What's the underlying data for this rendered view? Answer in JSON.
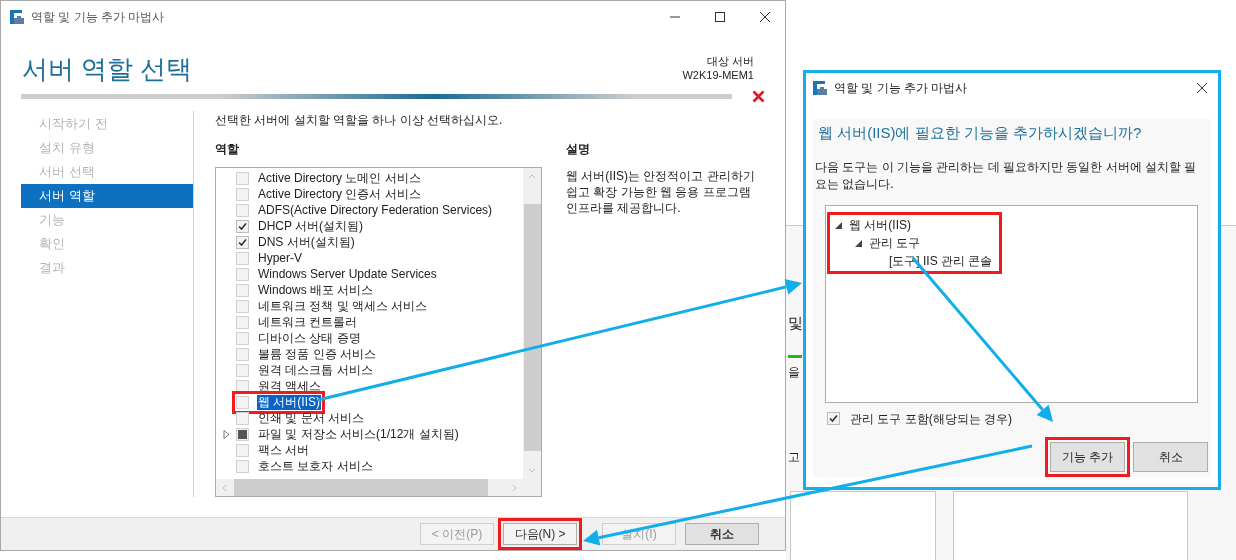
{
  "main_window": {
    "title": "역할 및 기능 추가 마법사",
    "heading": "서버 역할 선택",
    "target_label": "대상 서버",
    "target_server": "W2K19-MEM1",
    "nav": [
      {
        "label": "시작하기 전",
        "selected": false
      },
      {
        "label": "설치 유형",
        "selected": false
      },
      {
        "label": "서버 선택",
        "selected": false
      },
      {
        "label": "서버 역할",
        "selected": true
      },
      {
        "label": "기능",
        "selected": false
      },
      {
        "label": "확인",
        "selected": false
      },
      {
        "label": "결과",
        "selected": false
      }
    ],
    "instruction": "선택한 서버에 설치할 역할을 하나 이상 선택하십시오.",
    "roles_heading": "역할",
    "roles": [
      {
        "label": "Active Directory 노메인 서비스",
        "checked": false,
        "partial": false,
        "selected": false,
        "expandable": false,
        "highlighted": false
      },
      {
        "label": "Active Directory 인증서 서비스",
        "checked": false,
        "partial": false,
        "selected": false,
        "expandable": false,
        "highlighted": false
      },
      {
        "label": "ADFS(Active Directory Federation Services)",
        "checked": false,
        "partial": false,
        "selected": false,
        "expandable": false,
        "highlighted": false
      },
      {
        "label": "DHCP 서버(설치됨)",
        "checked": true,
        "partial": false,
        "selected": false,
        "expandable": false,
        "highlighted": false
      },
      {
        "label": "DNS 서버(설치됨)",
        "checked": true,
        "partial": false,
        "selected": false,
        "expandable": false,
        "highlighted": false
      },
      {
        "label": "Hyper-V",
        "checked": false,
        "partial": false,
        "selected": false,
        "expandable": false,
        "highlighted": false
      },
      {
        "label": "Windows Server Update Services",
        "checked": false,
        "partial": false,
        "selected": false,
        "expandable": false,
        "highlighted": false
      },
      {
        "label": "Windows 배포 서비스",
        "checked": false,
        "partial": false,
        "selected": false,
        "expandable": false,
        "highlighted": false
      },
      {
        "label": "네트워크 정책 및 액세스 서비스",
        "checked": false,
        "partial": false,
        "selected": false,
        "expandable": false,
        "highlighted": false
      },
      {
        "label": "네트워크 컨트롤러",
        "checked": false,
        "partial": false,
        "selected": false,
        "expandable": false,
        "highlighted": false
      },
      {
        "label": "디바이스 상태 증명",
        "checked": false,
        "partial": false,
        "selected": false,
        "expandable": false,
        "highlighted": false
      },
      {
        "label": "볼륨 정품 인증 서비스",
        "checked": false,
        "partial": false,
        "selected": false,
        "expandable": false,
        "highlighted": false
      },
      {
        "label": "원격 데스크톱 서비스",
        "checked": false,
        "partial": false,
        "selected": false,
        "expandable": false,
        "highlighted": false
      },
      {
        "label": "원격 액세스",
        "checked": false,
        "partial": false,
        "selected": false,
        "expandable": false,
        "highlighted": false
      },
      {
        "label": "웹 서버(IIS)",
        "checked": false,
        "partial": false,
        "selected": true,
        "expandable": false,
        "highlighted": true
      },
      {
        "label": "인쇄 및 문서 서비스",
        "checked": false,
        "partial": false,
        "selected": false,
        "expandable": false,
        "highlighted": false
      },
      {
        "label": "파일 및 저장소 서비스(1/12개 설치됨)",
        "checked": false,
        "partial": true,
        "selected": false,
        "expandable": true,
        "highlighted": false
      },
      {
        "label": "팩스 서버",
        "checked": false,
        "partial": false,
        "selected": false,
        "expandable": false,
        "highlighted": false
      },
      {
        "label": "호스트 보호자 서비스",
        "checked": false,
        "partial": false,
        "selected": false,
        "expandable": false,
        "highlighted": false
      }
    ],
    "description_heading": "설명",
    "description": "웹 서버(IIS)는 안정적이고 관리하기 쉽고 확장 가능한 웹 응용 프로그램 인프라를 제공합니다.",
    "buttons": [
      {
        "label": "< 이전(P)",
        "disabled": true,
        "default": false,
        "highlighted": false
      },
      {
        "label": "다음(N) >",
        "disabled": false,
        "default": false,
        "highlighted": true
      },
      {
        "label": "설치(I)",
        "disabled": true,
        "default": false,
        "highlighted": false
      },
      {
        "label": "취소",
        "disabled": false,
        "default": true,
        "highlighted": false
      }
    ]
  },
  "background_window": {
    "fragments": [
      "및",
      "을",
      "고"
    ]
  },
  "dialog": {
    "title": "역할 및 기능 추가 마법사",
    "question": "웹 서버(IIS)에 필요한 기능을 추가하시겠습니까?",
    "message": "다음 도구는 이 기능을 관리하는 데 필요하지만 동일한 서버에 설치할 필요는 없습니다.",
    "tree": [
      {
        "label": "웹 서버(IIS)",
        "expanded": true,
        "children": [
          {
            "label": "관리 도구",
            "expanded": true,
            "children": [
              {
                "label": "[도구] IIS 관리 콘솔"
              }
            ]
          }
        ]
      }
    ],
    "tree_highlighted": true,
    "include_tools": {
      "label": "관리 도구 포함(해당되는 경우)",
      "checked": true
    },
    "buttons": [
      {
        "label": "기능 추가",
        "highlighted": true
      },
      {
        "label": "취소",
        "highlighted": false
      }
    ]
  }
}
